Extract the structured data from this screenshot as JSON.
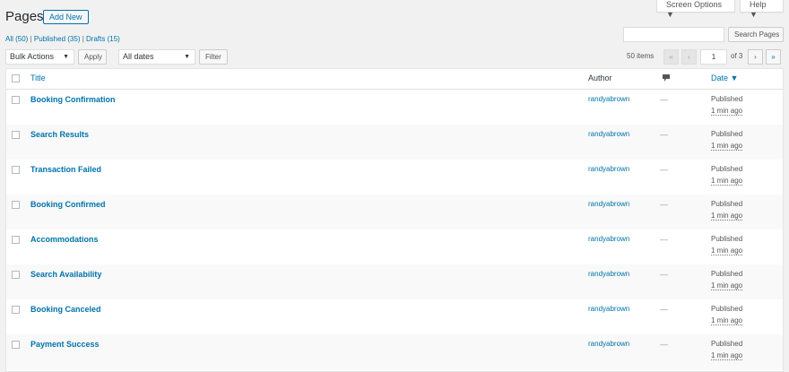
{
  "header": {
    "screen_options": "Screen Options ▼",
    "help": "Help ▼",
    "title": "Pages",
    "add_new": "Add New"
  },
  "filters": {
    "all": "All (50)",
    "published": "Published (35)",
    "drafts": "Drafts (15)",
    "sep": "|"
  },
  "search": {
    "value": "",
    "button": "Search Pages"
  },
  "toolbar": {
    "bulk_actions": "Bulk Actions",
    "apply": "Apply",
    "dates": "All dates",
    "filter": "Filter"
  },
  "pagination": {
    "items": "50 items",
    "first": "«",
    "prev": "‹",
    "current_page": "1",
    "of_total": "of 3",
    "next": "›",
    "last": "»"
  },
  "table": {
    "columns": {
      "title": "Title",
      "author": "Author",
      "comments_icon": "comment-icon",
      "date": "Date ▼"
    },
    "rows": [
      {
        "title": "Booking Confirmation",
        "author": "randyabrown",
        "comments": "—",
        "status": "Published",
        "ago": "1 min ago"
      },
      {
        "title": "Search Results",
        "author": "randyabrown",
        "comments": "—",
        "status": "Published",
        "ago": "1 min ago"
      },
      {
        "title": "Transaction Failed",
        "author": "randyabrown",
        "comments": "—",
        "status": "Published",
        "ago": "1 min ago"
      },
      {
        "title": "Booking Confirmed",
        "author": "randyabrown",
        "comments": "—",
        "status": "Published",
        "ago": "1 min ago"
      },
      {
        "title": "Accommodations",
        "author": "randyabrown",
        "comments": "—",
        "status": "Published",
        "ago": "1 min ago"
      },
      {
        "title": "Search Availability",
        "author": "randyabrown",
        "comments": "—",
        "status": "Published",
        "ago": "1 min ago"
      },
      {
        "title": "Booking Canceled",
        "author": "randyabrown",
        "comments": "—",
        "status": "Published",
        "ago": "1 min ago"
      },
      {
        "title": "Payment Success",
        "author": "randyabrown",
        "comments": "—",
        "status": "Published",
        "ago": "1 min ago"
      }
    ]
  },
  "colors": {
    "link": "#0073aa",
    "background": "#f1f1f1",
    "row_alt": "#f9f9f9"
  }
}
